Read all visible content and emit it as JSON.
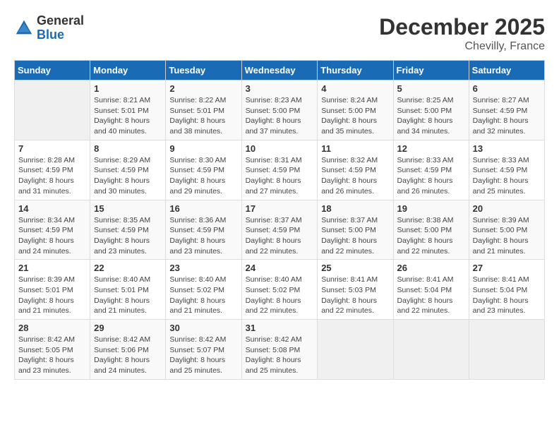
{
  "header": {
    "logo_general": "General",
    "logo_blue": "Blue",
    "month_title": "December 2025",
    "location": "Chevilly, France"
  },
  "weekdays": [
    "Sunday",
    "Monday",
    "Tuesday",
    "Wednesday",
    "Thursday",
    "Friday",
    "Saturday"
  ],
  "weeks": [
    [
      {
        "day": "",
        "sunrise": "",
        "sunset": "",
        "daylight": ""
      },
      {
        "day": "1",
        "sunrise": "Sunrise: 8:21 AM",
        "sunset": "Sunset: 5:01 PM",
        "daylight": "Daylight: 8 hours and 40 minutes."
      },
      {
        "day": "2",
        "sunrise": "Sunrise: 8:22 AM",
        "sunset": "Sunset: 5:01 PM",
        "daylight": "Daylight: 8 hours and 38 minutes."
      },
      {
        "day": "3",
        "sunrise": "Sunrise: 8:23 AM",
        "sunset": "Sunset: 5:00 PM",
        "daylight": "Daylight: 8 hours and 37 minutes."
      },
      {
        "day": "4",
        "sunrise": "Sunrise: 8:24 AM",
        "sunset": "Sunset: 5:00 PM",
        "daylight": "Daylight: 8 hours and 35 minutes."
      },
      {
        "day": "5",
        "sunrise": "Sunrise: 8:25 AM",
        "sunset": "Sunset: 5:00 PM",
        "daylight": "Daylight: 8 hours and 34 minutes."
      },
      {
        "day": "6",
        "sunrise": "Sunrise: 8:27 AM",
        "sunset": "Sunset: 4:59 PM",
        "daylight": "Daylight: 8 hours and 32 minutes."
      }
    ],
    [
      {
        "day": "7",
        "sunrise": "Sunrise: 8:28 AM",
        "sunset": "Sunset: 4:59 PM",
        "daylight": "Daylight: 8 hours and 31 minutes."
      },
      {
        "day": "8",
        "sunrise": "Sunrise: 8:29 AM",
        "sunset": "Sunset: 4:59 PM",
        "daylight": "Daylight: 8 hours and 30 minutes."
      },
      {
        "day": "9",
        "sunrise": "Sunrise: 8:30 AM",
        "sunset": "Sunset: 4:59 PM",
        "daylight": "Daylight: 8 hours and 29 minutes."
      },
      {
        "day": "10",
        "sunrise": "Sunrise: 8:31 AM",
        "sunset": "Sunset: 4:59 PM",
        "daylight": "Daylight: 8 hours and 27 minutes."
      },
      {
        "day": "11",
        "sunrise": "Sunrise: 8:32 AM",
        "sunset": "Sunset: 4:59 PM",
        "daylight": "Daylight: 8 hours and 26 minutes."
      },
      {
        "day": "12",
        "sunrise": "Sunrise: 8:33 AM",
        "sunset": "Sunset: 4:59 PM",
        "daylight": "Daylight: 8 hours and 26 minutes."
      },
      {
        "day": "13",
        "sunrise": "Sunrise: 8:33 AM",
        "sunset": "Sunset: 4:59 PM",
        "daylight": "Daylight: 8 hours and 25 minutes."
      }
    ],
    [
      {
        "day": "14",
        "sunrise": "Sunrise: 8:34 AM",
        "sunset": "Sunset: 4:59 PM",
        "daylight": "Daylight: 8 hours and 24 minutes."
      },
      {
        "day": "15",
        "sunrise": "Sunrise: 8:35 AM",
        "sunset": "Sunset: 4:59 PM",
        "daylight": "Daylight: 8 hours and 23 minutes."
      },
      {
        "day": "16",
        "sunrise": "Sunrise: 8:36 AM",
        "sunset": "Sunset: 4:59 PM",
        "daylight": "Daylight: 8 hours and 23 minutes."
      },
      {
        "day": "17",
        "sunrise": "Sunrise: 8:37 AM",
        "sunset": "Sunset: 4:59 PM",
        "daylight": "Daylight: 8 hours and 22 minutes."
      },
      {
        "day": "18",
        "sunrise": "Sunrise: 8:37 AM",
        "sunset": "Sunset: 5:00 PM",
        "daylight": "Daylight: 8 hours and 22 minutes."
      },
      {
        "day": "19",
        "sunrise": "Sunrise: 8:38 AM",
        "sunset": "Sunset: 5:00 PM",
        "daylight": "Daylight: 8 hours and 22 minutes."
      },
      {
        "day": "20",
        "sunrise": "Sunrise: 8:39 AM",
        "sunset": "Sunset: 5:00 PM",
        "daylight": "Daylight: 8 hours and 21 minutes."
      }
    ],
    [
      {
        "day": "21",
        "sunrise": "Sunrise: 8:39 AM",
        "sunset": "Sunset: 5:01 PM",
        "daylight": "Daylight: 8 hours and 21 minutes."
      },
      {
        "day": "22",
        "sunrise": "Sunrise: 8:40 AM",
        "sunset": "Sunset: 5:01 PM",
        "daylight": "Daylight: 8 hours and 21 minutes."
      },
      {
        "day": "23",
        "sunrise": "Sunrise: 8:40 AM",
        "sunset": "Sunset: 5:02 PM",
        "daylight": "Daylight: 8 hours and 21 minutes."
      },
      {
        "day": "24",
        "sunrise": "Sunrise: 8:40 AM",
        "sunset": "Sunset: 5:02 PM",
        "daylight": "Daylight: 8 hours and 22 minutes."
      },
      {
        "day": "25",
        "sunrise": "Sunrise: 8:41 AM",
        "sunset": "Sunset: 5:03 PM",
        "daylight": "Daylight: 8 hours and 22 minutes."
      },
      {
        "day": "26",
        "sunrise": "Sunrise: 8:41 AM",
        "sunset": "Sunset: 5:04 PM",
        "daylight": "Daylight: 8 hours and 22 minutes."
      },
      {
        "day": "27",
        "sunrise": "Sunrise: 8:41 AM",
        "sunset": "Sunset: 5:04 PM",
        "daylight": "Daylight: 8 hours and 23 minutes."
      }
    ],
    [
      {
        "day": "28",
        "sunrise": "Sunrise: 8:42 AM",
        "sunset": "Sunset: 5:05 PM",
        "daylight": "Daylight: 8 hours and 23 minutes."
      },
      {
        "day": "29",
        "sunrise": "Sunrise: 8:42 AM",
        "sunset": "Sunset: 5:06 PM",
        "daylight": "Daylight: 8 hours and 24 minutes."
      },
      {
        "day": "30",
        "sunrise": "Sunrise: 8:42 AM",
        "sunset": "Sunset: 5:07 PM",
        "daylight": "Daylight: 8 hours and 25 minutes."
      },
      {
        "day": "31",
        "sunrise": "Sunrise: 8:42 AM",
        "sunset": "Sunset: 5:08 PM",
        "daylight": "Daylight: 8 hours and 25 minutes."
      },
      {
        "day": "",
        "sunrise": "",
        "sunset": "",
        "daylight": ""
      },
      {
        "day": "",
        "sunrise": "",
        "sunset": "",
        "daylight": ""
      },
      {
        "day": "",
        "sunrise": "",
        "sunset": "",
        "daylight": ""
      }
    ]
  ]
}
